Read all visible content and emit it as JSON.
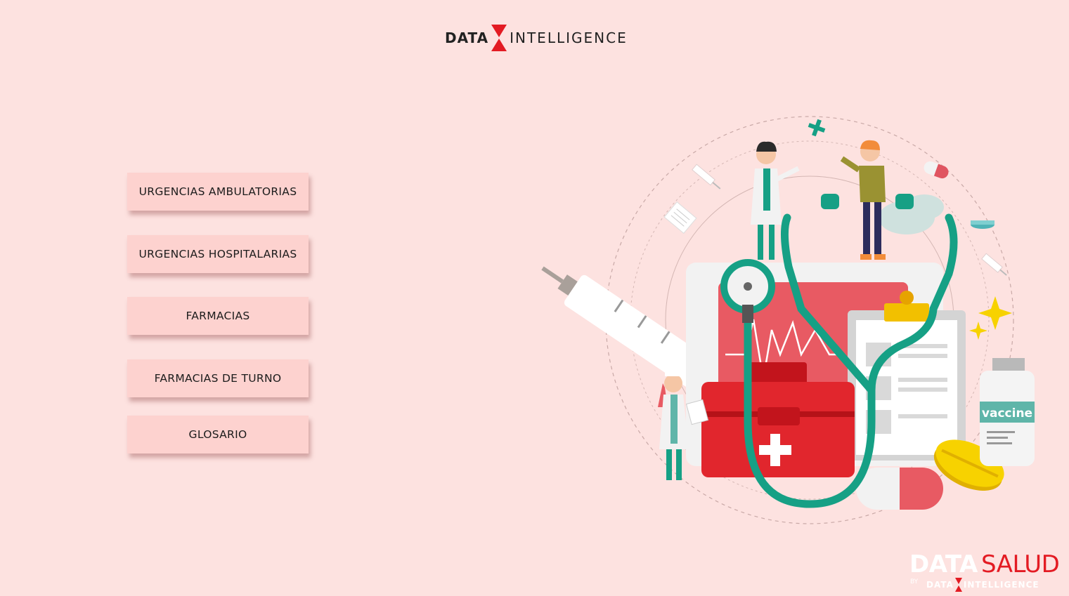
{
  "header": {
    "logo_word1": "DATA",
    "logo_word2": "INTELLIGENCE"
  },
  "menu": [
    {
      "label": "URGENCIAS AMBULATORIAS"
    },
    {
      "label": "URGENCIAS HOSPITALARIAS"
    },
    {
      "label": "FARMACIAS"
    },
    {
      "label": "FARMACIAS DE TURNO"
    },
    {
      "label": "GLOSARIO"
    }
  ],
  "illustration": {
    "vaccine_label": "vaccine"
  },
  "brand": {
    "data": "DATA",
    "salud": "SALUD",
    "by": "BY",
    "sub_word1": "DATA",
    "sub_word2": "INTELLIGENCE"
  },
  "colors": {
    "background": "#fde2e0",
    "button": "#fdd2cf",
    "accent_red": "#e31b23",
    "teal": "#16a085"
  }
}
